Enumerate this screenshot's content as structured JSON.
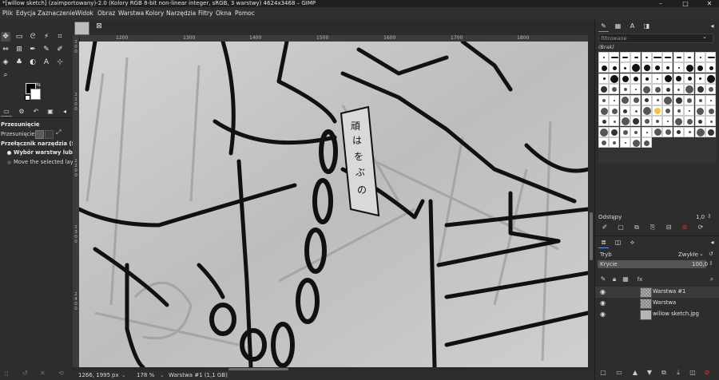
{
  "window": {
    "title": "*[willow sketch] (zaimportowany)-2.0 (Kolory RGB 8-bit non-linear integer, sRGB, 3 warstwy) 4624x3468 – GIMP",
    "minimize": "–",
    "maximize": "□",
    "close": "✕"
  },
  "menu": [
    "Plik",
    "Edycja",
    "Zaznaczenie",
    "Widok",
    "Obraz",
    "Warstwa",
    "Kolory",
    "Narzędzia",
    "Filtry",
    "Okna",
    "Pomoc"
  ],
  "tool_options": {
    "title": "Przesunięcie",
    "move_label": "Przesunięcie:",
    "switch_label": "Przełącznik narzędzia (Shi",
    "radio_1": "Wybór warstwy lub p",
    "radio_2": "Move the selected lay"
  },
  "rulers": {
    "top": [
      "1200",
      "1300",
      "1400",
      "1500",
      "1600",
      "1700",
      "1800"
    ],
    "left": [
      "2\n0\n0",
      "2\n1\n0\n0",
      "2\n2\n0\n0",
      "2\n3\n0\n0",
      "2\n4\n0\n0"
    ]
  },
  "status": {
    "coords": "1266, 1995",
    "unit": "px",
    "zoom": "178 %",
    "layer_info": "Warstwa #1 (1,1 GB)"
  },
  "brushes": {
    "filter_placeholder": "filtrowane",
    "current": "(Brak)"
  },
  "spacing": {
    "label": "Odstępy",
    "value": "1,0"
  },
  "layers": {
    "mode_label": "Tryb",
    "mode_value": "Zwykłe",
    "opacity_label": "Krycie",
    "opacity_value": "100,0",
    "items": [
      {
        "name": "Warstwa #1"
      },
      {
        "name": "Warstwa"
      },
      {
        "name": "willow sketch.jpg"
      }
    ]
  },
  "colors": {
    "fg": "#000000",
    "bg": "#ffffff",
    "accent": "#4e9bf1"
  }
}
